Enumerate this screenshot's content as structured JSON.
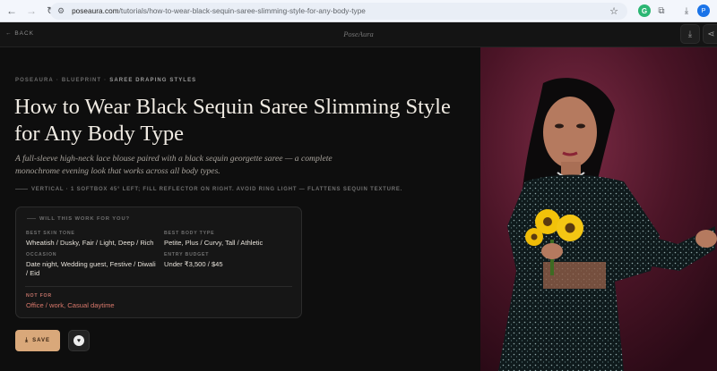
{
  "browser": {
    "url_host": "poseaura.com",
    "url_path": "/tutorials/how-to-wear-black-sequin-saree-slimming-style-for-any-body-type",
    "profile_initial": "P"
  },
  "header": {
    "back_label": "BACK",
    "brand": "PoseAura"
  },
  "breadcrumb": {
    "items": [
      "POSEAURA",
      "BLUEPRINT",
      "SAREE DRAPING STYLES"
    ]
  },
  "article": {
    "title": "How to Wear Black Sequin Saree Slimming Style for Any Body Type",
    "lede": "A full-sleeve high-neck lace blouse paired with a black sequin georgette saree — a complete monochrome evening look that works across all body types.",
    "tip": "VERTICAL · 1 SOFTBOX 45° LEFT; FILL REFLECTOR ON RIGHT. AVOID RING LIGHT — FLATTENS SEQUIN TEXTURE."
  },
  "card": {
    "heading": "WILL THIS WORK FOR YOU?",
    "skin_tone_label": "BEST SKIN TONE",
    "skin_tone_value": "Wheatish / Dusky, Fair / Light, Deep / Rich",
    "body_type_label": "BEST BODY TYPE",
    "body_type_value": "Petite, Plus / Curvy, Tall / Athletic",
    "occasion_label": "OCCASION",
    "occasion_value": "Date night, Wedding guest, Festive / Diwali / Eid",
    "budget_label": "ENTRY BUDGET",
    "budget_value": "Under ₹3,500 / $45",
    "not_for_label": "NOT FOR",
    "not_for_value": "Office / work, Casual daytime"
  },
  "actions": {
    "save_label": "SAVE"
  },
  "colors": {
    "accent": "#d9a87a",
    "warning": "#d9786b",
    "background": "#0e0e0e"
  }
}
